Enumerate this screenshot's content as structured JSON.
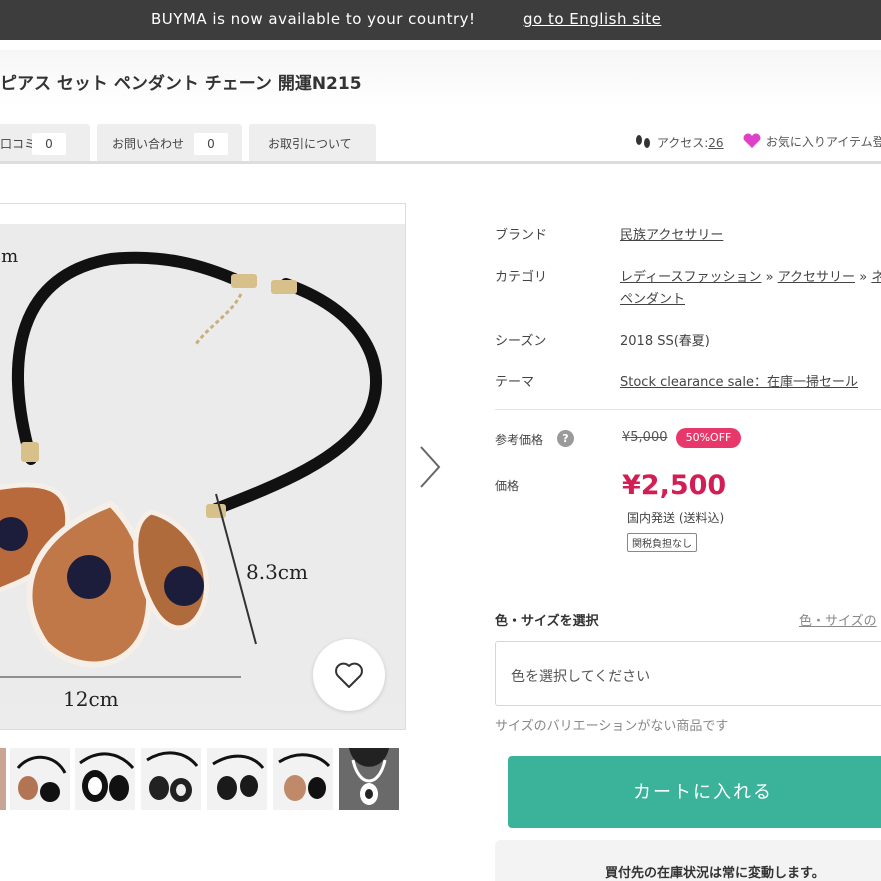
{
  "banner": {
    "message": "BUYMA is now available to your country!",
    "link": "go to English site"
  },
  "product": {
    "title": "ピアス セット ペンダント チェーン 開運N215"
  },
  "tabs": [
    {
      "label": "口コミ",
      "count": "0"
    },
    {
      "label": "お問い合わせ",
      "count": "0"
    },
    {
      "label": "お取引について"
    }
  ],
  "stats": {
    "access_label": "アクセス:",
    "access_count": "26",
    "favorite_label": "お気に入りアイテム登"
  },
  "image": {
    "dim_length": "cm",
    "dim_height": "8.3cm",
    "dim_width": "12cm"
  },
  "details": {
    "brand_label": "ブランド",
    "brand_value": "民族アクセサリー",
    "category_label": "カテゴリ",
    "category_path": [
      "レディースファッション",
      "アクセサリー",
      "ネッ"
    ],
    "category_sep": "»",
    "category_last": "ペンダント",
    "season_label": "シーズン",
    "season_value": "2018 SS(春夏)",
    "theme_label": "テーマ",
    "theme_value": "Stock clearance sale：在庫一掃セール"
  },
  "pricing": {
    "ref_label": "参考価格",
    "ref_price": "¥5,000",
    "discount": "50%OFF",
    "price_label": "価格",
    "price": "¥2,500",
    "shipping": "国内発送 (送料込)",
    "tax_badge": "関税負担なし",
    "help_glyph": "?"
  },
  "selection": {
    "title": "色・サイズを選択",
    "link": "色・サイズの",
    "placeholder": "色を選択してください",
    "no_variation": "サイズのバリエーションがない商品です"
  },
  "cart": {
    "button": "カートに入れる"
  },
  "notice": {
    "text": "買付先の在庫状況は常に変動します。"
  },
  "colors": {
    "accent_green": "#3bb39a",
    "price_red": "#d31d55",
    "badge_pink": "#e8386b"
  }
}
